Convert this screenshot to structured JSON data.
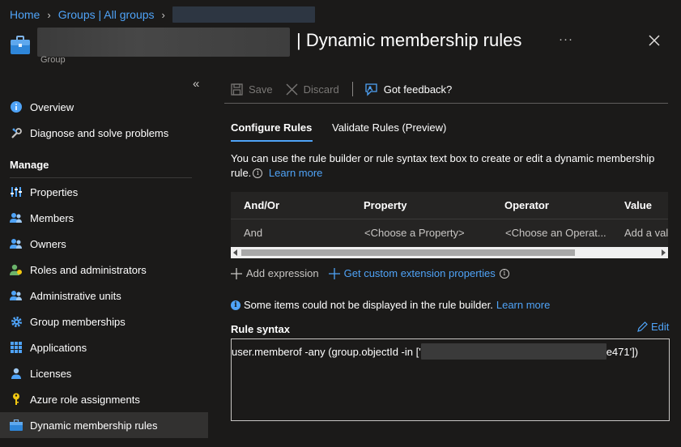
{
  "breadcrumb": {
    "home": "Home",
    "groups": "Groups | All groups"
  },
  "header": {
    "title_suffix": "| Dynamic membership rules",
    "subtitle": "Group",
    "more": "···"
  },
  "sidebar": {
    "items": [
      {
        "label": "Overview",
        "icon": "info-icon"
      },
      {
        "label": "Diagnose and solve problems",
        "icon": "wrench-icon"
      }
    ],
    "section": "Manage",
    "manage_items": [
      {
        "label": "Properties",
        "icon": "properties-icon"
      },
      {
        "label": "Members",
        "icon": "members-icon"
      },
      {
        "label": "Owners",
        "icon": "owners-icon"
      },
      {
        "label": "Roles and administrators",
        "icon": "roles-icon"
      },
      {
        "label": "Administrative units",
        "icon": "admin-units-icon"
      },
      {
        "label": "Group memberships",
        "icon": "gear-icon"
      },
      {
        "label": "Applications",
        "icon": "grid-icon"
      },
      {
        "label": "Licenses",
        "icon": "licenses-icon"
      },
      {
        "label": "Azure role assignments",
        "icon": "key-icon"
      },
      {
        "label": "Dynamic membership rules",
        "icon": "briefcase-icon",
        "active": true
      }
    ]
  },
  "toolbar": {
    "save": "Save",
    "discard": "Discard",
    "feedback": "Got feedback?"
  },
  "tabs": {
    "configure": "Configure Rules",
    "validate": "Validate Rules (Preview)"
  },
  "description": {
    "text": "You can use the rule builder or rule syntax text box to create or edit a dynamic membership rule.",
    "learn_more": "Learn more"
  },
  "table": {
    "headers": [
      "And/Or",
      "Property",
      "Operator",
      "Value"
    ],
    "row": [
      "And",
      "<Choose a Property>",
      "<Choose an Operat...",
      "Add a val"
    ]
  },
  "actions": {
    "add_expression": "Add expression",
    "custom_ext": "Get custom extension properties"
  },
  "notice": {
    "text": "Some items could not be displayed in the rule builder.",
    "learn_more": "Learn more"
  },
  "rule_syntax": {
    "label": "Rule syntax",
    "edit": "Edit",
    "prefix": "user.memberof -any (group.objectId -in ['",
    "suffix": "e471'])"
  },
  "colors": {
    "accent": "#4fa3f7",
    "background": "#1b1a19",
    "active_nav": "#323130"
  }
}
